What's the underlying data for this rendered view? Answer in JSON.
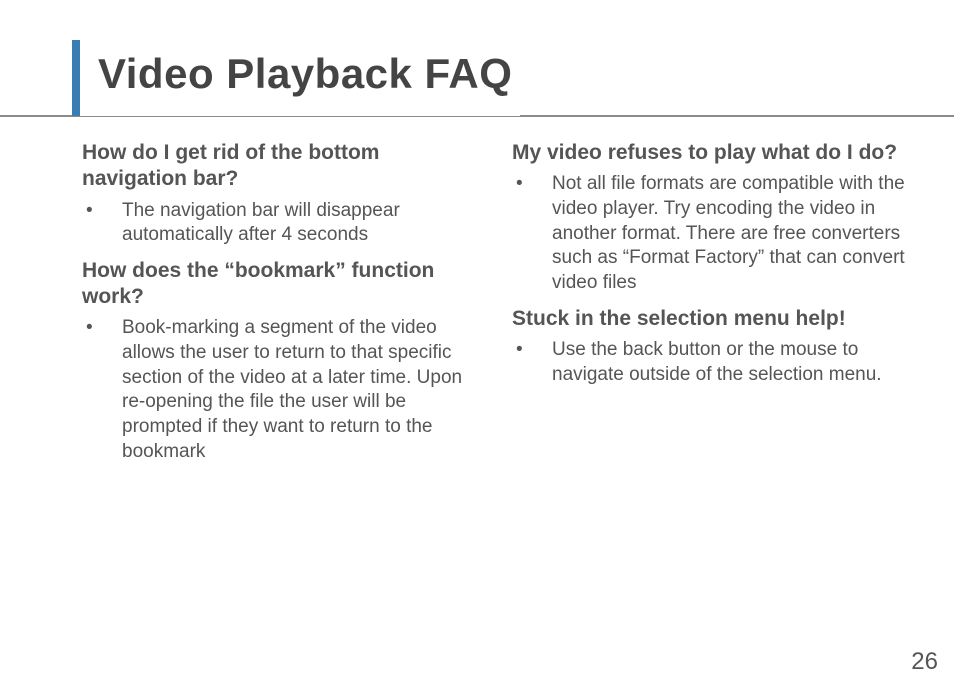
{
  "header": {
    "title": "Video Playback FAQ"
  },
  "columns": {
    "left": {
      "q1": "How do I get rid of the bottom navigation bar?",
      "a1": "The navigation bar will disappear automatically after 4 seconds",
      "q2": "How does the “bookmark” func­tion work?",
      "a2": "Book-marking a segment of the video allows the user to return to that specific section of the video at a later time.  Upon re-opening the file the user will be prompted if they want to return to the book­mark"
    },
    "right": {
      "q1": "My video refuses to play what do I do?",
      "a1": "Not all file formats are compatible with the video player.  Try encoding the video in another format.  There are free converters such as “Format Fac­tory” that can convert video files",
      "q2": "Stuck in the selection menu help!",
      "a2": "Use the back button or the mouse to navigate outside of the selection menu."
    }
  },
  "page_number": "26"
}
